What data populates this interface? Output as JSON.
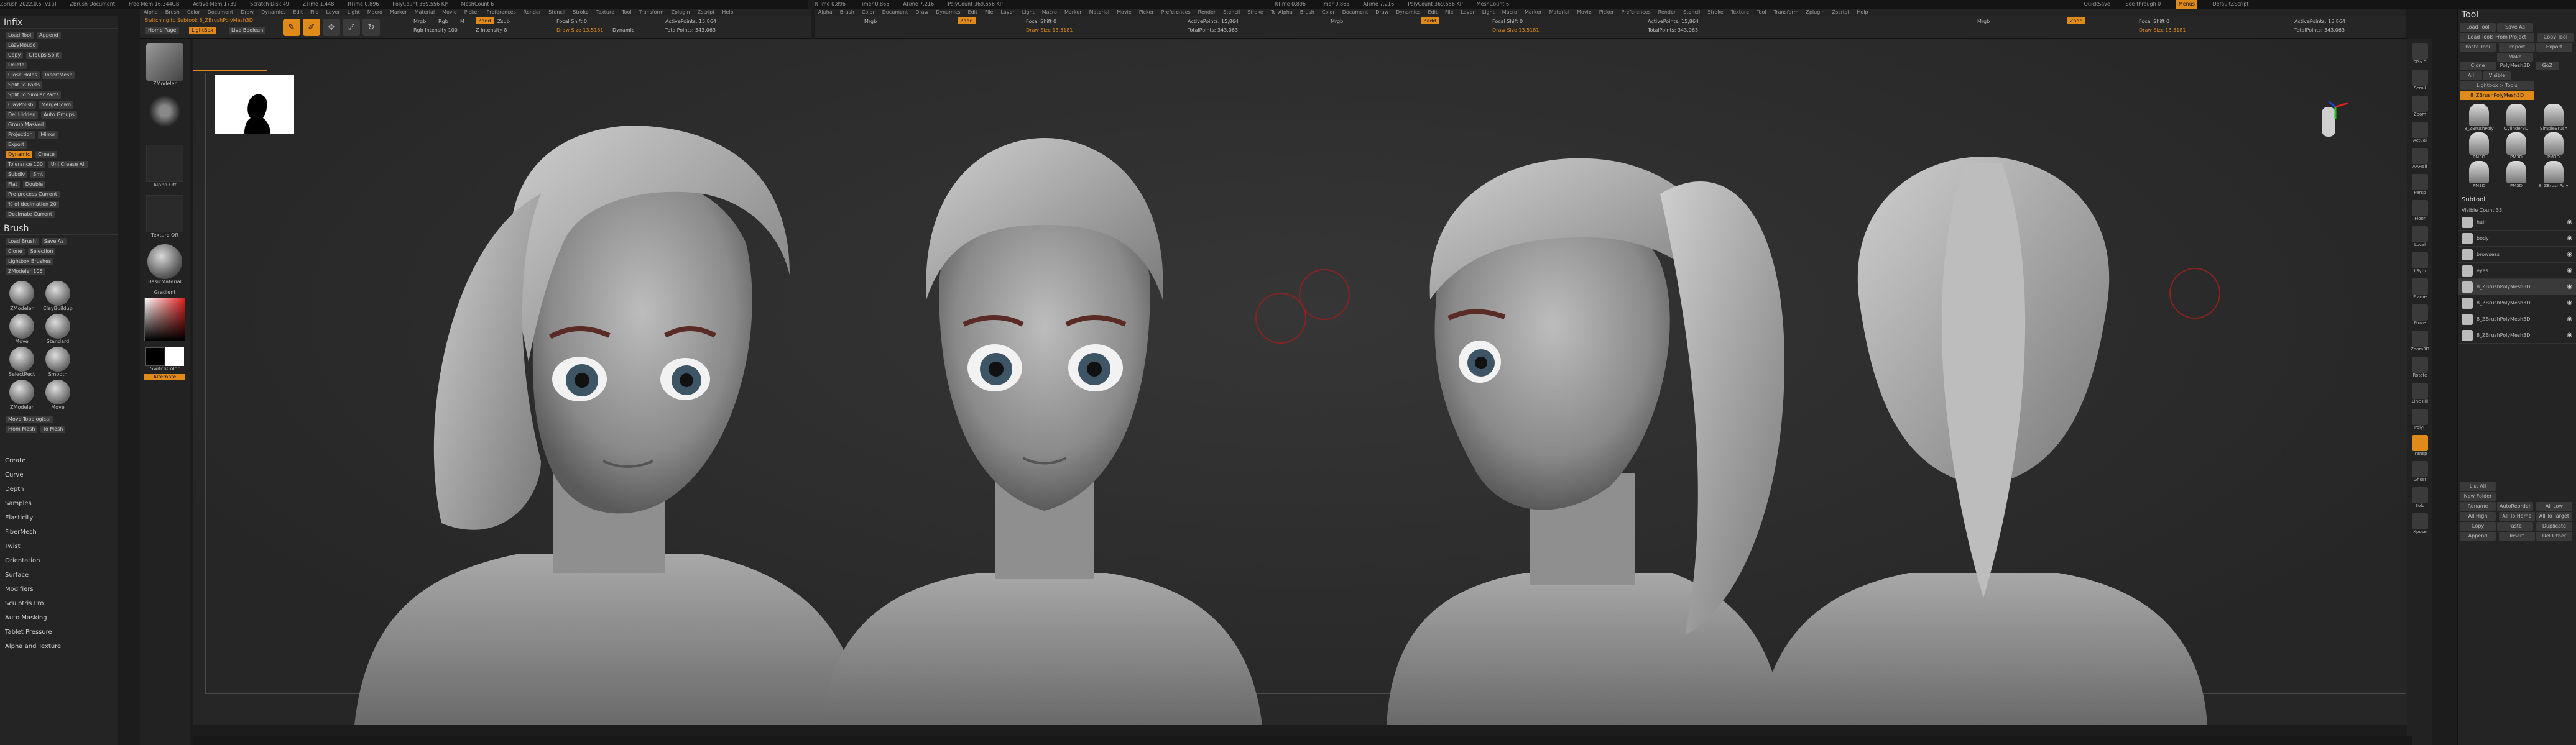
{
  "titles": [
    "ZBrush 2022.0.5 [v1u]",
    "ZBrush Document",
    "Free Mem 16.344GB",
    "Active Mem 1739",
    "Scratch Disk 49",
    "ZTime 1.448",
    "RTime 0.896",
    "Timer 0.865",
    "ATime 7.216",
    "PolyCount 369.556 KP",
    "MeshCount 6",
    "QuickSave",
    "See-through 0",
    "Menus",
    "DefaultZScript"
  ],
  "menus": [
    "Alpha",
    "Brush",
    "Color",
    "Document",
    "Draw",
    "Dynamics",
    "Edit",
    "File",
    "Layer",
    "Light",
    "Macro",
    "Marker",
    "Material",
    "Movie",
    "Picker",
    "Preferences",
    "Render",
    "Stencil",
    "Stroke",
    "Texture",
    "Tool",
    "Transform",
    "Zplugin",
    "Zscript",
    "Help"
  ],
  "toolbar": {
    "modes": [
      "Edit",
      "Draw",
      "Move",
      "Scale",
      "Rotate"
    ],
    "channels": [
      "Mrgb",
      "Rgb",
      "M",
      "Zadd",
      "Zsub",
      "Zcut"
    ],
    "focal_shift": "Focal Shift 0",
    "draw_size": "Draw Size 13.5181",
    "dynamic": "Dynamic",
    "rgb_intensity": "Rgb Intensity 100",
    "z_intensity": "Z Intensity 8",
    "active_points": "ActivePoints: 15,864",
    "total_points": "TotalPoints: 343,063",
    "switching": "Switching to Subtool: 8_ZBrushPolyMesh3D",
    "home_page": "Home Page",
    "lightbox": "LightBox",
    "live_boolean": "Live Boolean"
  },
  "left_panel": {
    "title": "Infix",
    "load_tool": "Load Tool",
    "append": "Append",
    "lazymouse": "LazyMouse",
    "copy": "Copy",
    "groups_split": "Groups Split",
    "delete": "Delete",
    "close_holes": "Close Holes",
    "insert_mesh": "InsertMesh",
    "split_to_parts": "Split To Parts",
    "split_to_similar": "Split To Similar Parts",
    "clay_polish": "ClayPolish",
    "merge_down": "MergeDown",
    "del_hidden": "Del Hidden",
    "auto_groups": "Auto Groups",
    "group_masked": "Group Masked",
    "projection": "Projection",
    "mirror": "Mirror",
    "export": "Export",
    "dynamic_btn": "Dynamic",
    "create": "Create",
    "tolerance": "Tolerance 100",
    "uniform": "Uni Crease All",
    "subdiv": "Subdiv",
    "smt": "Smt",
    "flat": "Flat",
    "double": "Double",
    "pre_process": "Pre-process Current",
    "decimation": "% of decimation 20",
    "decimate_current": "Decimate Current"
  },
  "brush_panel": {
    "title": "Brush",
    "load_brush": "Load Brush",
    "save_as": "Save As",
    "clone": "Clone",
    "selection": "Selection",
    "lightbox_brushes": "Lightbox Brushes",
    "zmodeler_val": "ZModeler 106",
    "brushes": [
      "ZModeler",
      "ClayBuildup",
      "Move",
      "Standard",
      "SelectRect",
      "Smooth",
      "ZModeler",
      "Move"
    ],
    "move_topo": "Move Topological",
    "from_mesh": "From Mesh",
    "to_mesh": "To Mesh"
  },
  "left_list": [
    "Create",
    "Curve",
    "Depth",
    "Samples",
    "Elasticity",
    "FiberMesh",
    "Twist",
    "Orientation",
    "Surface",
    "Modifiers",
    "Sculptris Pro",
    "Auto Masking",
    "Tablet Pressure",
    "Alpha and Texture"
  ],
  "shelf": {
    "ztool_label": "ZModeler",
    "alpha_label": "Alpha Off",
    "texture_label": "Texture Off",
    "material_label": "BasicMaterial",
    "gradient_label": "Gradient",
    "switch_color": "SwitchColor",
    "alternate": "Alternate"
  },
  "right_panel": {
    "tool_title": "Tool",
    "load_tool": "Load Tool",
    "save_as": "Save As",
    "load_from_project": "Load Tools From Project",
    "copy_tool": "Copy Tool",
    "paste_tool": "Paste Tool",
    "import": "Import",
    "export": "Export",
    "clone": "Clone",
    "make_polymesh": "Make PolyMesh3D",
    "goz": "GoZ",
    "all": "All",
    "visible": "Visible",
    "lightbox_tools": "Lightbox > Tools",
    "current_tool": "8_ZBrushPolyMesh3D",
    "tool_thumbs": [
      "8_ZBrushPoly",
      "Cylinder3D",
      "SimpleBrush",
      "PM3D",
      "PM3D",
      "PM3D",
      "PM3D",
      "PM3D",
      "8_ZBrushPoly"
    ],
    "subtool_title": "Subtool",
    "visible_count": "Visible Count 33",
    "subtools": [
      "hair",
      "body",
      "browsess",
      "eyes",
      "8_ZBrushPolyMesh3D",
      "8_ZBrushPolyMesh3D",
      "8_ZBrushPolyMesh3D",
      "8_ZBrushPolyMesh3D"
    ],
    "list_all": "List All",
    "new_folder": "New Folder",
    "rename": "Rename",
    "autoreorder": "AutoReorder",
    "all_low": "All Low",
    "all_high": "All High",
    "all_to_home": "All To Home",
    "all_to_target": "All To Target",
    "copy": "Copy",
    "paste": "Paste",
    "duplicate": "Duplicate",
    "append": "Append",
    "insert": "Insert",
    "del_other": "Del Other"
  },
  "right_shelf": [
    "SPix 3",
    "Scroll",
    "Zoom",
    "Actual",
    "AAHalf",
    "Persp",
    "Floor",
    "Local",
    "LSym",
    "Frame",
    "Move",
    "Zoom3D",
    "Rotate",
    "Line Fill",
    "PolyF",
    "Transp",
    "Ghost",
    "Solo",
    "Xpose"
  ],
  "colors": {
    "accent": "#e08a1a",
    "bg": "#1c1c1c",
    "panel": "#262626",
    "canvas": "#2e2e2e"
  }
}
